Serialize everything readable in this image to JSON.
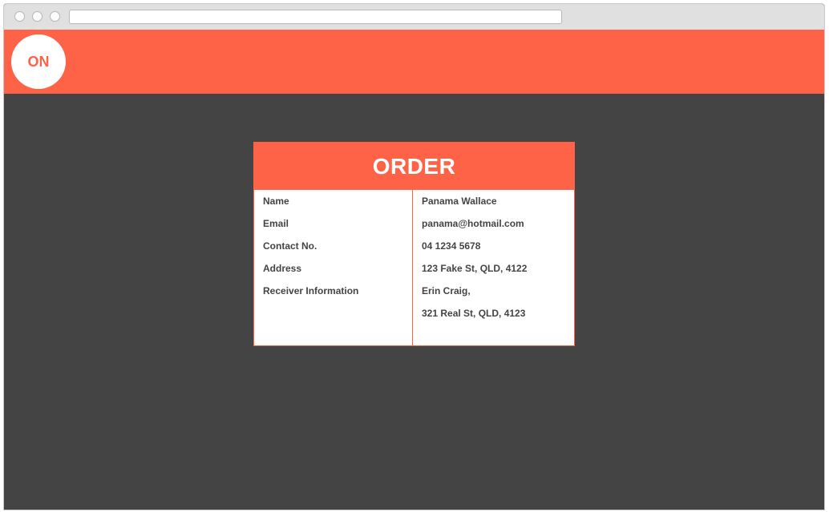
{
  "header": {
    "logo_text": "ON"
  },
  "order": {
    "title": "ORDER",
    "labels": [
      "Name",
      "Email",
      "Contact No.",
      "Address",
      "Receiver Information"
    ],
    "values": [
      "Panama Wallace",
      "panama@hotmail.com",
      "04 1234 5678",
      "123 Fake St, QLD, 4122",
      "Erin Craig,",
      "321 Real St, QLD, 4123"
    ]
  },
  "colors": {
    "accent": "#ff6347",
    "background": "#444444",
    "text": "#444444"
  }
}
